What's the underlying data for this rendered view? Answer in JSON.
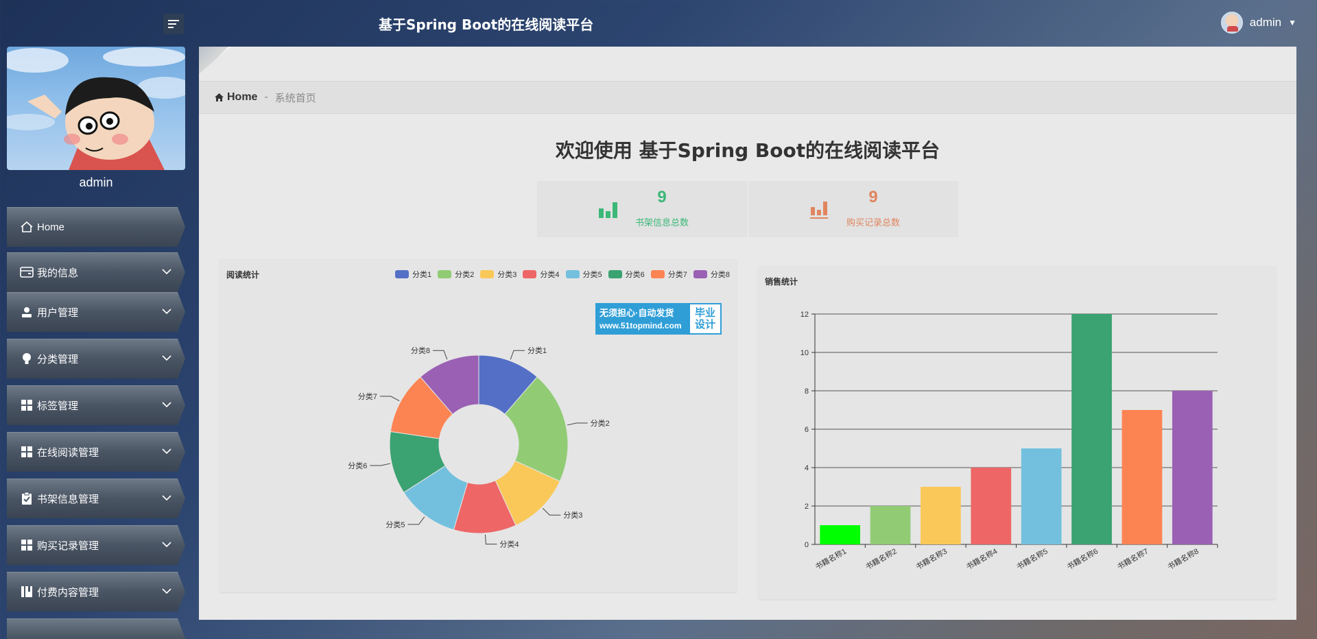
{
  "header": {
    "title": "基于Spring Boot的在线阅读平台",
    "username": "admin"
  },
  "sidebar": {
    "profile_name": "admin",
    "items": [
      {
        "label": "Home",
        "icon": "home-icon"
      },
      {
        "label": "我的信息",
        "icon": "id-card-icon"
      },
      {
        "label": "用户管理",
        "icon": "user-icon"
      },
      {
        "label": "分类管理",
        "icon": "lightbulb-icon"
      },
      {
        "label": "标签管理",
        "icon": "grid-icon"
      },
      {
        "label": "在线阅读管理",
        "icon": "grid-icon"
      },
      {
        "label": "书架信息管理",
        "icon": "clipboard-check-icon"
      },
      {
        "label": "购买记录管理",
        "icon": "grid-icon"
      },
      {
        "label": "付费内容管理",
        "icon": "book-icon"
      }
    ]
  },
  "breadcrumb": {
    "home": "Home",
    "separator": "-",
    "current": "系统首页"
  },
  "welcome": "欢迎使用 基于Spring Boot的在线阅读平台",
  "stats": [
    {
      "value": "9",
      "label": "书架信息总数",
      "color": "#3cb878"
    },
    {
      "value": "9",
      "label": "购买记录总数",
      "color": "#e0855f"
    }
  ],
  "watermark": {
    "line1": "无须担心·自动发货",
    "line2": "www.51topmind.com",
    "right1": "毕业",
    "right2": "设计"
  },
  "chart_data": [
    {
      "type": "pie",
      "title": "阅读统计",
      "donut": true,
      "legend_position": "top-right",
      "categories": [
        "分类1",
        "分类2",
        "分类3",
        "分类4",
        "分类5",
        "分类6",
        "分类7",
        "分类8"
      ],
      "values": [
        10,
        18,
        10,
        10,
        10,
        10,
        10,
        10
      ],
      "colors": [
        "#5470c6",
        "#91cc75",
        "#fac858",
        "#ee6666",
        "#73c0de",
        "#3ba272",
        "#fc8452",
        "#9a60b4"
      ]
    },
    {
      "type": "bar",
      "title": "销售统计",
      "categories": [
        "书籍名称1",
        "书籍名称2",
        "书籍名称3",
        "书籍名称4",
        "书籍名称5",
        "书籍名称6",
        "书籍名称7",
        "书籍名称8"
      ],
      "values": [
        1,
        2,
        3,
        4,
        5,
        12,
        7,
        8
      ],
      "colors": [
        "#00ff00",
        "#91cc75",
        "#fac858",
        "#ee6666",
        "#73c0de",
        "#3ba272",
        "#fc8452",
        "#9a60b4"
      ],
      "ylim": [
        0,
        12
      ],
      "yticks": [
        0,
        2,
        4,
        6,
        8,
        10,
        12
      ],
      "grid": true
    }
  ]
}
